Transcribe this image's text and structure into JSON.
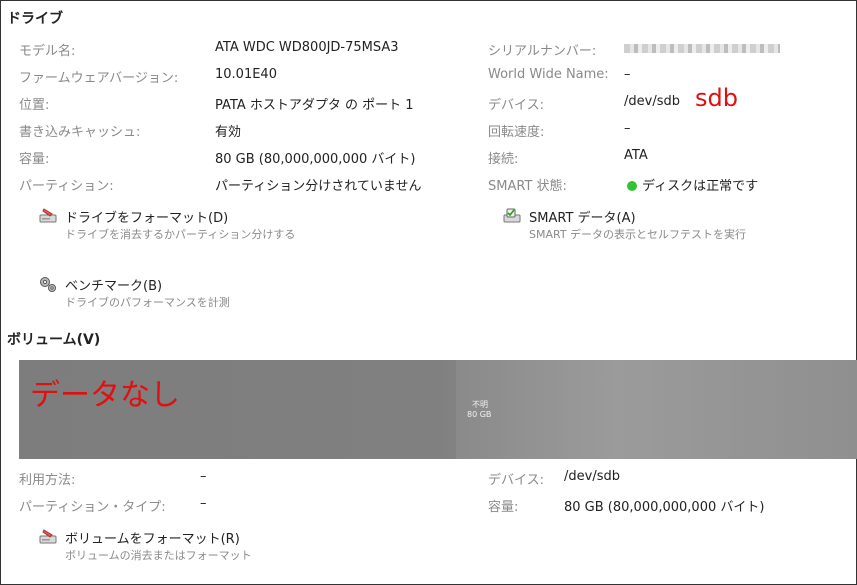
{
  "drive": {
    "title": "ドライブ",
    "left": [
      {
        "label": "モデル名:",
        "value": "ATA WDC WD800JD-75MSA3"
      },
      {
        "label": "ファームウェアバージョン:",
        "value": "10.01E40"
      },
      {
        "label": "位置:",
        "value": "PATA ホストアダプタ の ポート 1"
      },
      {
        "label": "書き込みキャッシュ:",
        "value": "有効"
      },
      {
        "label": "容量:",
        "value": "80 GB (80,000,000,000 バイト)"
      },
      {
        "label": "パーティション:",
        "value": "パーティション分けされていません"
      }
    ],
    "right": [
      {
        "label": "シリアルナンバー:",
        "value": ""
      },
      {
        "label": "World Wide Name:",
        "value": "–"
      },
      {
        "label": "デバイス:",
        "value": "/dev/sdb"
      },
      {
        "label": "回転速度:",
        "value": "–"
      },
      {
        "label": "接続:",
        "value": "ATA"
      },
      {
        "label": "SMART 状態:",
        "value": "ディスクは正常です"
      }
    ],
    "actions": {
      "format": {
        "title": "ドライブをフォーマット(D)",
        "subtitle": "ドライブを消去するかパーティション分けする"
      },
      "smart": {
        "title": "SMART データ(A)",
        "subtitle": "SMART データの表示とセルフテストを実行"
      },
      "benchmark": {
        "title": "ベンチマーク(B)",
        "subtitle": "ドライブのパフォーマンスを計測"
      }
    },
    "annotation": "sdb",
    "status_color": "#33c333"
  },
  "volumes": {
    "title": "ボリューム(V)",
    "bar_annotation": "データなし",
    "segment": {
      "name": "不明",
      "size": "80 GB"
    },
    "left": [
      {
        "label": "利用方法:",
        "value": "–"
      },
      {
        "label": "パーティション・タイプ:",
        "value": "–"
      }
    ],
    "right": [
      {
        "label": "デバイス:",
        "value": "/dev/sdb"
      },
      {
        "label": "容量:",
        "value": "80 GB (80,000,000,000 バイト)"
      }
    ],
    "action": {
      "title": "ボリュームをフォーマット(R)",
      "subtitle": "ボリュームの消去またはフォーマット"
    }
  },
  "colors": {
    "annotation_red": "#e01010",
    "label_gray": "#8a8a8a"
  }
}
